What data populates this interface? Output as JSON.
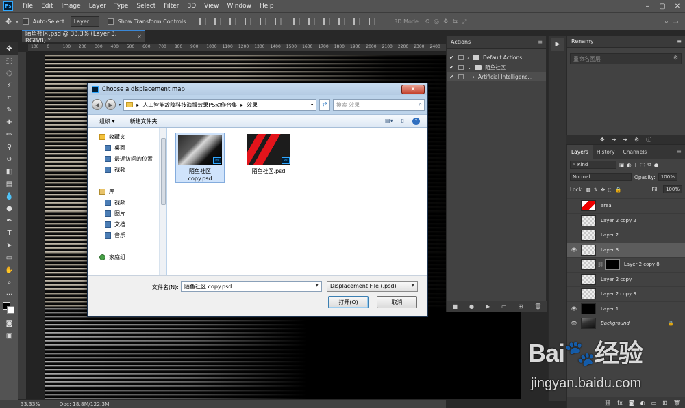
{
  "menubar": {
    "app_icon": "Ps",
    "items": [
      "File",
      "Edit",
      "Image",
      "Layer",
      "Type",
      "Select",
      "Filter",
      "3D",
      "View",
      "Window",
      "Help"
    ],
    "window_controls": [
      "–",
      "▢",
      "✕"
    ]
  },
  "options_bar": {
    "auto_select_label": "Auto-Select:",
    "auto_select_value": "Layer",
    "show_transform_label": "Show Transform Controls",
    "mode_label": "3D Mode:"
  },
  "document_tab": {
    "title": "陌鱼社区.psd @ 33.3% (Layer 3, RGB/8) *"
  },
  "ruler": {
    "labels": [
      "100",
      "0",
      "100",
      "200",
      "300",
      "400",
      "500",
      "600",
      "700",
      "800",
      "900",
      "1000",
      "1100",
      "1200",
      "1300",
      "1400",
      "1500",
      "1600",
      "1700",
      "1800",
      "1900",
      "2000",
      "2100",
      "2200",
      "2300",
      "2400",
      "2500",
      "2600"
    ]
  },
  "status_bar": {
    "zoom": "33.33%",
    "doc": "Doc: 18.8M/122.3M"
  },
  "actions_panel": {
    "tab_label": "Actions",
    "rows": [
      {
        "label": "Default Actions",
        "checked": true,
        "expanded": false
      },
      {
        "label": "陌鱼社区",
        "checked": true,
        "expanded": true
      },
      {
        "label": "Artificial Intelligenc...",
        "checked": true,
        "expanded": false,
        "selected": true
      }
    ]
  },
  "rename_panel": {
    "tab_label": "Renamy",
    "input_placeholder": "重命名图层"
  },
  "layers_panel": {
    "tabs": [
      "Layers",
      "History",
      "Channels"
    ],
    "kind_label": "Kind",
    "blend_mode": "Normal",
    "opacity_label": "Opacity:",
    "opacity_value": "100%",
    "lock_label": "Lock:",
    "fill_label": "Fill:",
    "fill_value": "100%",
    "layers": [
      {
        "name": "area",
        "visible": false,
        "thumb": "red"
      },
      {
        "name": "Layer 2 copy 2",
        "visible": false,
        "thumb": "checker"
      },
      {
        "name": "Layer 2",
        "visible": false,
        "thumb": "checker"
      },
      {
        "name": "Layer 3",
        "visible": true,
        "thumb": "checker",
        "selected": true
      },
      {
        "name": "Layer 2 copy 8",
        "visible": false,
        "thumb": "checker",
        "mask": true
      },
      {
        "name": "Layer 2 copy",
        "visible": false,
        "thumb": "checker"
      },
      {
        "name": "Layer 2 copy 3",
        "visible": false,
        "thumb": "checker"
      },
      {
        "name": "Layer 1",
        "visible": true,
        "thumb": "black"
      },
      {
        "name": "Background",
        "visible": true,
        "thumb": "photo",
        "locked": true
      }
    ]
  },
  "dialog": {
    "title": "Choose a displacement map",
    "breadcrumb": [
      "人工智能故障科技海报效果PS动作合集",
      "效果"
    ],
    "search_placeholder": "搜索 效果",
    "organize_label": "组织 ▾",
    "new_folder_label": "新建文件夹",
    "nav": {
      "favorites_label": "收藏夹",
      "favorites": [
        "桌面",
        "最近访问的位置",
        "视频"
      ],
      "libraries_label": "库",
      "libraries": [
        "视频",
        "图片",
        "文档",
        "音乐"
      ],
      "homegroup_label": "家庭组"
    },
    "files": [
      {
        "name": "陌鱼社区 copy.psd",
        "selected": true
      },
      {
        "name": "陌鱼社区.psd",
        "selected": false
      }
    ],
    "filename_label": "文件名(N):",
    "filename_value": "陌鱼社区 copy.psd",
    "filetype_value": "Displacement File (.psd)",
    "open_button": "打开(O)",
    "cancel_button": "取消"
  },
  "watermark": {
    "logo_text": "Bai🐾经验",
    "url": "jingyan.baidu.com"
  }
}
